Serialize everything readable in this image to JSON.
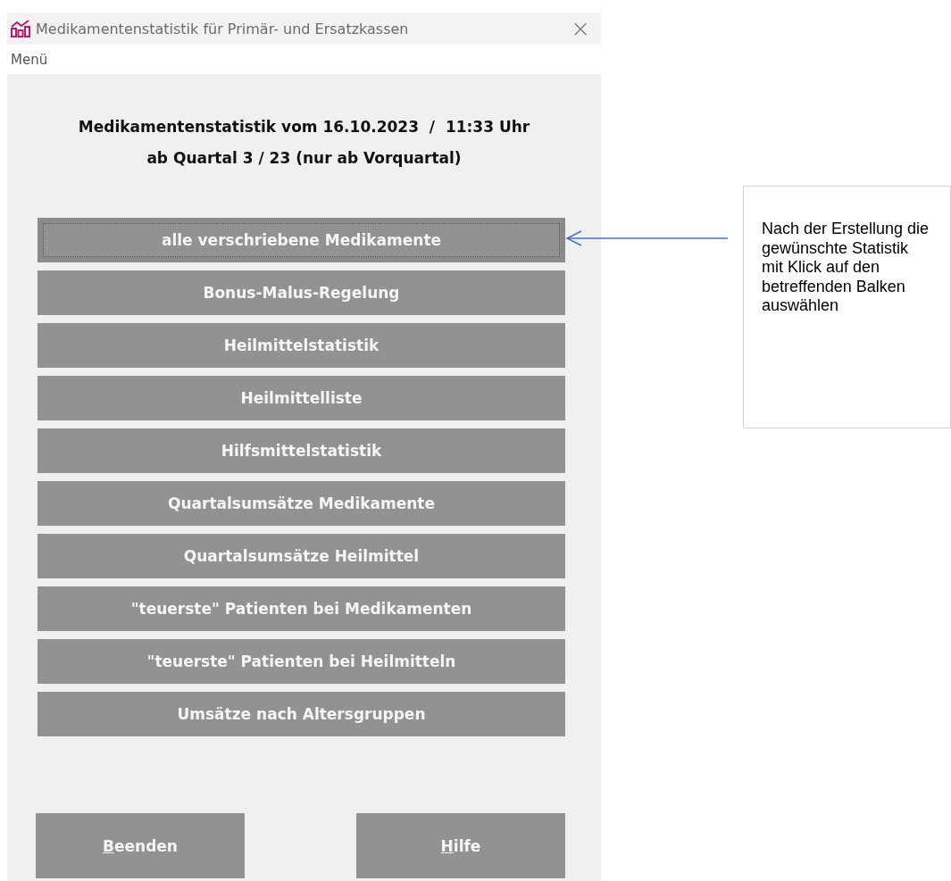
{
  "window": {
    "title": "Medikamentenstatistik für Primär- und Ersatzkassen",
    "close": "×"
  },
  "menu_bar": [
    "Menü"
  ],
  "heading": [
    "Medikamentenstatistik vom 16.10.2023  /  11:33 Uhr",
    "ab Quartal 3 / 23 (nur ab Vorquartal)"
  ],
  "statistics": [
    {
      "label": "alle verschriebene Medikamente",
      "focused": true
    },
    {
      "label": "Bonus-Malus-Regelung",
      "focused": false
    },
    {
      "label": "Heilmittelstatistik",
      "focused": false
    },
    {
      "label": "Heilmittelliste",
      "focused": false
    },
    {
      "label": "Hilfsmittelstatistik",
      "focused": false
    },
    {
      "label": "Quartalsumsätze Medikamente",
      "focused": false
    },
    {
      "label": "Quartalsumsätze Heilmittel",
      "focused": false
    },
    {
      "label": "\"teuerste\" Patienten bei Medikamenten",
      "focused": false
    },
    {
      "label": "\"teuerste\" Patienten bei Heilmitteln",
      "focused": false
    },
    {
      "label": "Umsätze nach Altersgruppen",
      "focused": false
    }
  ],
  "footer_buttons": [
    "Beenden",
    "Hilfe"
  ],
  "callout": {
    "text": "Nach der Erstellung die gewünschte Statistik mit Klick auf den betreffenden Balken auswählen"
  }
}
